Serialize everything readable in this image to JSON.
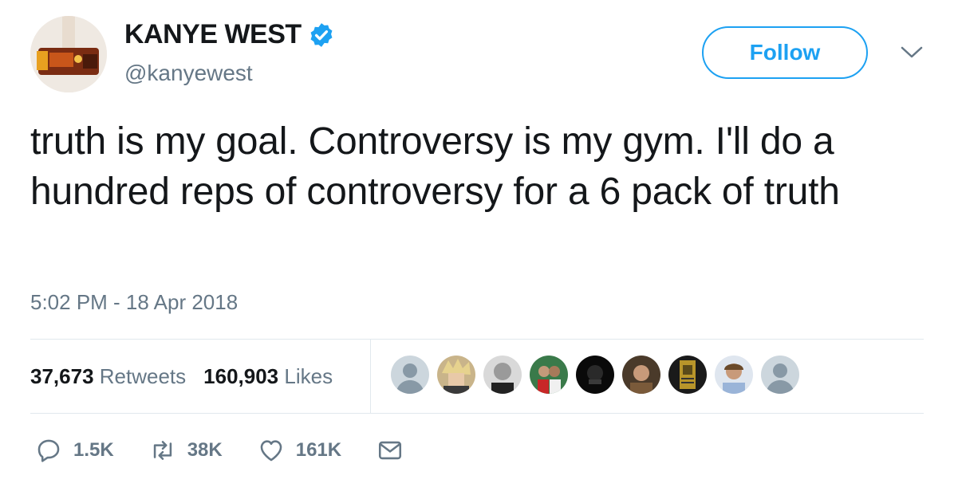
{
  "author": {
    "display_name": "KANYE WEST",
    "handle": "@kanyewest",
    "verified": true
  },
  "follow_label": "Follow",
  "tweet": {
    "text": "truth is my goal. Controversy is my gym. I'll do a hundred reps of controversy for a 6 pack of truth",
    "timestamp": "5:02 PM - 18 Apr 2018"
  },
  "stats": {
    "retweets_count": "37,673",
    "retweets_label": "Retweets",
    "likes_count": "160,903",
    "likes_label": "Likes"
  },
  "actions": {
    "replies": "1.5K",
    "retweets": "38K",
    "likes": "161K"
  },
  "colors": {
    "accent": "#1da1f2",
    "muted": "#657786",
    "text": "#14171a",
    "divider": "#e1e8ed"
  },
  "icons": [
    "verified-badge-icon",
    "chevron-down-icon",
    "reply-icon",
    "retweet-icon",
    "like-icon",
    "direct-message-icon"
  ]
}
